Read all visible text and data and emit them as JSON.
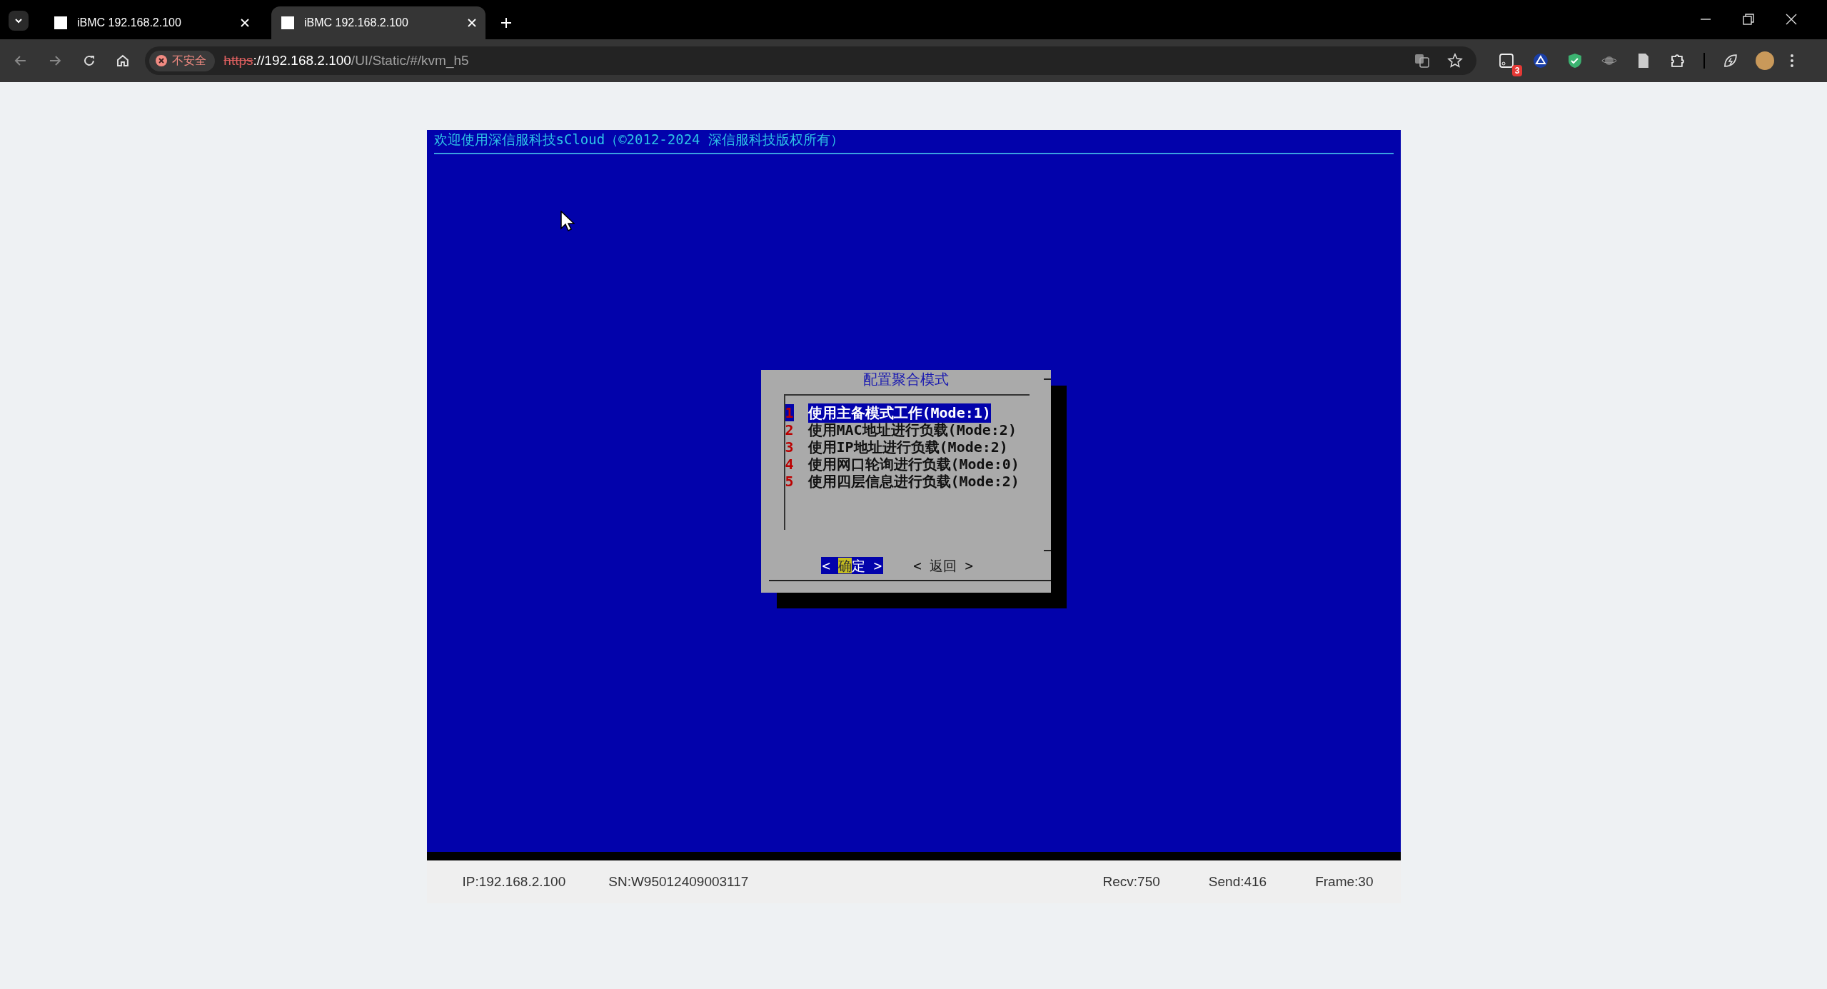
{
  "browser": {
    "tabs": [
      {
        "title": "iBMC 192.168.2.100",
        "selected": false
      },
      {
        "title": "iBMC 192.168.2.100",
        "selected": true
      }
    ],
    "security_chip": "不安全",
    "url": {
      "scheme": "https",
      "host": "://192.168.2.100",
      "path": "/UI/Static/#/kvm_h5"
    },
    "extension_badge": "3"
  },
  "console": {
    "header": "欢迎使用深信服科技sCloud（©2012-2024 深信服科技版权所有）",
    "dialog": {
      "title": "配置聚合模式",
      "items": [
        {
          "number": "1",
          "label": "使用主备模式工作(Mode:1)",
          "selected": true
        },
        {
          "number": "2",
          "label": "使用MAC地址进行负载(Mode:2)",
          "selected": false
        },
        {
          "number": "3",
          "label": "使用IP地址进行负载(Mode:2)",
          "selected": false
        },
        {
          "number": "4",
          "label": "使用网口轮询进行负载(Mode:0)",
          "selected": false
        },
        {
          "number": "5",
          "label": "使用四层信息进行负载(Mode:2)",
          "selected": false
        }
      ],
      "buttons": [
        {
          "open": "<",
          "label": "确定",
          "close": ">",
          "selected": true
        },
        {
          "open": "<",
          "label": "返回",
          "close": ">",
          "selected": false
        }
      ]
    }
  },
  "status_bar": {
    "left": [
      "IP:192.168.2.100",
      "SN:W95012409003117"
    ],
    "right": [
      "Recv:750",
      "Send:416",
      "Frame:30"
    ]
  }
}
